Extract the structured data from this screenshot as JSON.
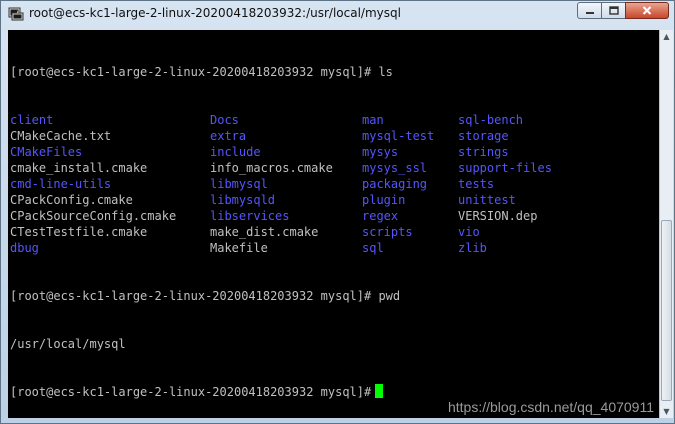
{
  "window": {
    "title": "root@ecs-kc1-large-2-linux-20200418203932:/usr/local/mysql"
  },
  "terminal": {
    "prompt1": "[root@ecs-kc1-large-2-linux-20200418203932 mysql]# ls",
    "ls_rows": [
      [
        {
          "t": "client",
          "k": "dir"
        },
        {
          "t": "Docs",
          "k": "dir"
        },
        {
          "t": "man",
          "k": "dir"
        },
        {
          "t": "sql-bench",
          "k": "dir"
        }
      ],
      [
        {
          "t": "CMakeCache.txt",
          "k": "file"
        },
        {
          "t": "extra",
          "k": "dir"
        },
        {
          "t": "mysql-test",
          "k": "dir"
        },
        {
          "t": "storage",
          "k": "dir"
        }
      ],
      [
        {
          "t": "CMakeFiles",
          "k": "dir"
        },
        {
          "t": "include",
          "k": "dir"
        },
        {
          "t": "mysys",
          "k": "dir"
        },
        {
          "t": "strings",
          "k": "dir"
        }
      ],
      [
        {
          "t": "cmake_install.cmake",
          "k": "file"
        },
        {
          "t": "info_macros.cmake",
          "k": "file"
        },
        {
          "t": "mysys_ssl",
          "k": "dir"
        },
        {
          "t": "support-files",
          "k": "dir"
        }
      ],
      [
        {
          "t": "cmd-line-utils",
          "k": "dir"
        },
        {
          "t": "libmysql",
          "k": "dir"
        },
        {
          "t": "packaging",
          "k": "dir"
        },
        {
          "t": "tests",
          "k": "dir"
        }
      ],
      [
        {
          "t": "CPackConfig.cmake",
          "k": "file"
        },
        {
          "t": "libmysqld",
          "k": "dir"
        },
        {
          "t": "plugin",
          "k": "dir"
        },
        {
          "t": "unittest",
          "k": "dir"
        }
      ],
      [
        {
          "t": "CPackSourceConfig.cmake",
          "k": "file"
        },
        {
          "t": "libservices",
          "k": "dir"
        },
        {
          "t": "regex",
          "k": "dir"
        },
        {
          "t": "VERSION.dep",
          "k": "file"
        }
      ],
      [
        {
          "t": "CTestTestfile.cmake",
          "k": "file"
        },
        {
          "t": "make_dist.cmake",
          "k": "file"
        },
        {
          "t": "scripts",
          "k": "dir"
        },
        {
          "t": "vio",
          "k": "dir"
        }
      ],
      [
        {
          "t": "dbug",
          "k": "dir"
        },
        {
          "t": "Makefile",
          "k": "file"
        },
        {
          "t": "sql",
          "k": "dir"
        },
        {
          "t": "zlib",
          "k": "dir"
        }
      ]
    ],
    "prompt2": "[root@ecs-kc1-large-2-linux-20200418203932 mysql]# pwd",
    "pwd_output": "/usr/local/mysql",
    "prompt3": "[root@ecs-kc1-large-2-linux-20200418203932 mysql]#"
  },
  "colors": {
    "directory": "#5555ff",
    "file": "#c0c0c0",
    "cursor": "#00ff00",
    "background": "#000000"
  },
  "icons": {
    "window_icon": "putty-terminal-icon",
    "minimize": "minimize-icon",
    "maximize": "maximize-icon",
    "close": "close-icon"
  },
  "watermark": "https://blog.csdn.net/qq_4070911"
}
